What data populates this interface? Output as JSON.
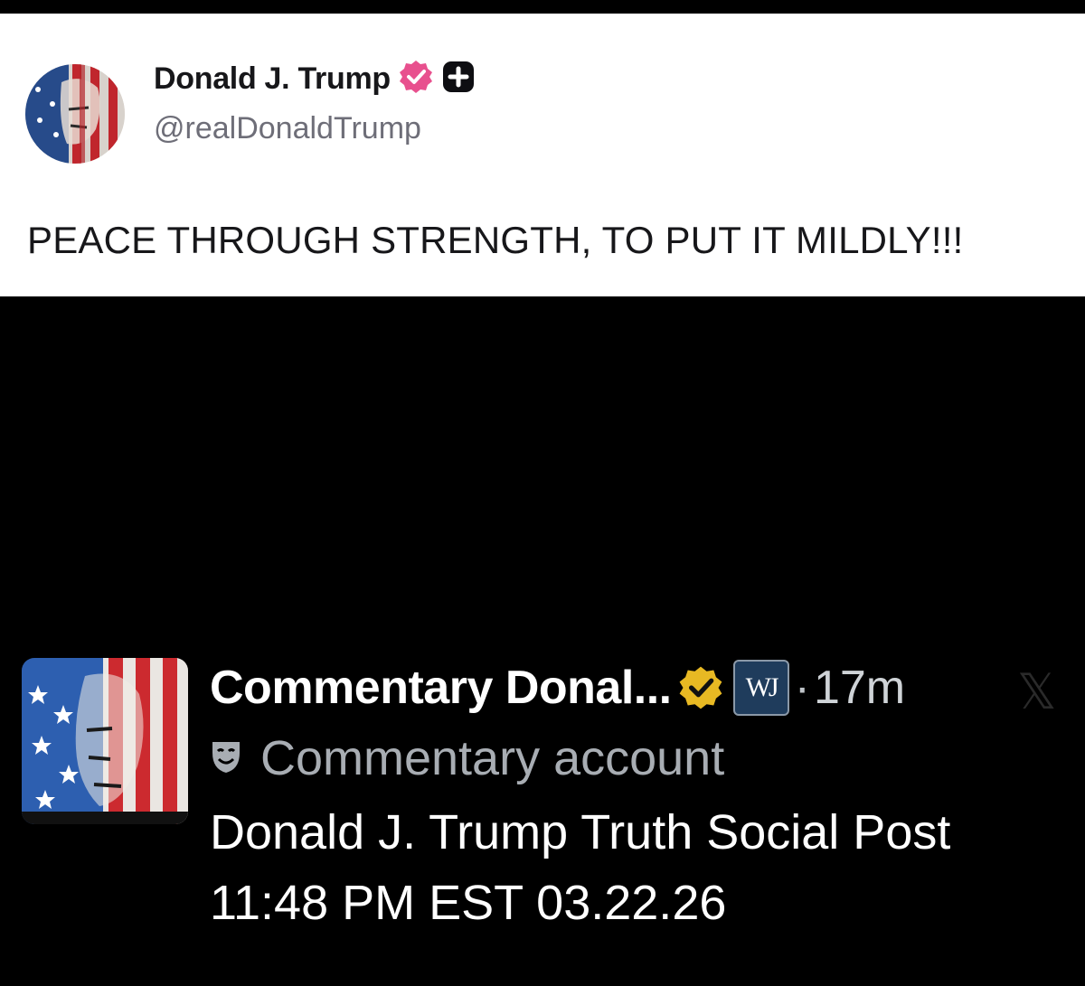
{
  "truth_post": {
    "author_name": "Donald J. Trump",
    "handle": "@realDonaldTrump",
    "body": "PEACE THROUGH STRENGTH, TO PUT IT MILDLY!!!",
    "icons": [
      "avatar-flag-portrait",
      "verified-badge-icon",
      "plus-badge-icon"
    ],
    "colors": {
      "verified": "#e8508e",
      "plus_badge": "#0e0e12"
    }
  },
  "x_post": {
    "display_name": "Commentary Donal...",
    "affiliate_badge": "WJ",
    "separator": "·",
    "timestamp": "17m",
    "sub_label": "Commentary account",
    "lines": [
      "Donald J. Trump Truth Social Post",
      "11:48 PM EST 03.22.26"
    ],
    "icons": [
      "avatar-flag-portrait",
      "gold-verified-badge-icon",
      "x-logo-icon",
      "theater-mask-icon"
    ],
    "colors": {
      "verified": "#e8b923",
      "affiliate_bg": "#1f3c5c"
    }
  }
}
